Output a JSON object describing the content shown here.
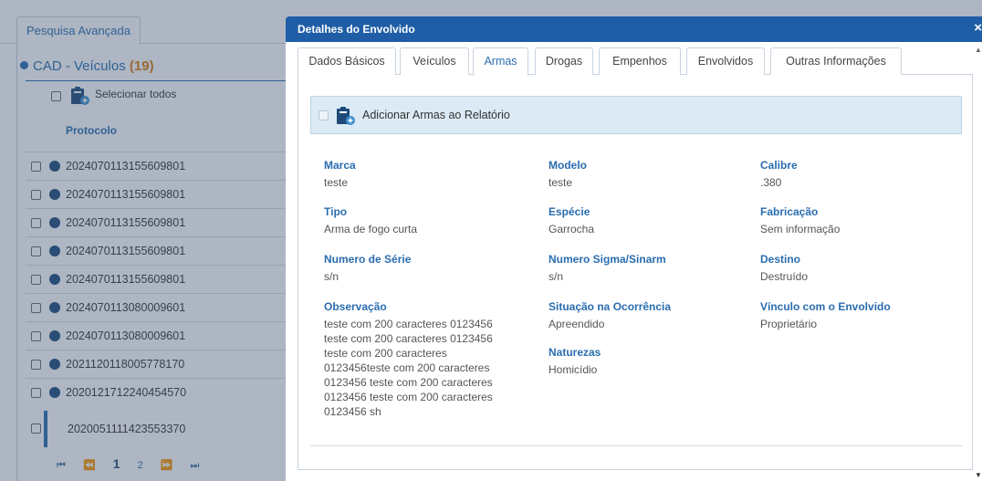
{
  "left": {
    "tab_label": "Pesquisa Avançada",
    "cad_title": "CAD - Veículos",
    "cad_count": "(19)",
    "select_all_label": "Selecionar todos",
    "protocol_header": "Protocolo",
    "rows": [
      "2024070113155609801",
      "2024070113155609801",
      "2024070113155609801",
      "2024070113155609801",
      "2024070113155609801",
      "2024070113080009601",
      "2024070113080009601",
      "2021120118005778170",
      "2020121712240454570"
    ],
    "active_row": "2020051111423553370",
    "pager": {
      "first": "⏮",
      "prev": "⏪",
      "page1": "1",
      "page2": "2",
      "next": "⏩",
      "last": "⏭"
    }
  },
  "modal": {
    "title": "Detalhes do Envolvido",
    "close": "×",
    "tabs": [
      "Dados Básicos",
      "Veículos",
      "Armas",
      "Drogas",
      "Empenhos",
      "Envolvidos",
      "Outras Informações"
    ],
    "active_tab": "Armas",
    "add_label": "Adicionar Armas ao Relatório",
    "fields": {
      "marca": {
        "label": "Marca",
        "value": "teste"
      },
      "modelo": {
        "label": "Modelo",
        "value": "teste"
      },
      "calibre": {
        "label": "Calibre",
        "value": ".380"
      },
      "tipo": {
        "label": "Tipo",
        "value": "Arma de fogo curta"
      },
      "especie": {
        "label": "Espécie",
        "value": "Garrocha"
      },
      "fabricacao": {
        "label": "Fabricação",
        "value": "Sem informação"
      },
      "serie": {
        "label": "Numero de Série",
        "value": "s/n"
      },
      "sigma": {
        "label": "Numero Sigma/Sinarm",
        "value": "s/n"
      },
      "destino": {
        "label": "Destino",
        "value": "Destruído"
      },
      "observacao": {
        "label": "Observação",
        "lines": [
          "teste com 200 caracteres 0123456",
          "teste com 200 caracteres 0123456",
          "teste com 200 caracteres",
          "0123456teste com 200 caracteres",
          "0123456 teste com 200 caracteres",
          "0123456 teste com 200 caracteres",
          "0123456 sh"
        ]
      },
      "situacao": {
        "label": "Situação na Ocorrência",
        "value": "Apreendido"
      },
      "naturezas": {
        "label": "Naturezas",
        "value": "Homicídio"
      },
      "vinculo": {
        "label": "Vínculo com o Envolvido",
        "value": "Proprietário"
      }
    }
  },
  "colors": {
    "header_blue": "#1f5ea6",
    "link_blue": "#2a6db0",
    "count_orange": "#e07a10",
    "addbar_bg": "#dbeaf4"
  }
}
